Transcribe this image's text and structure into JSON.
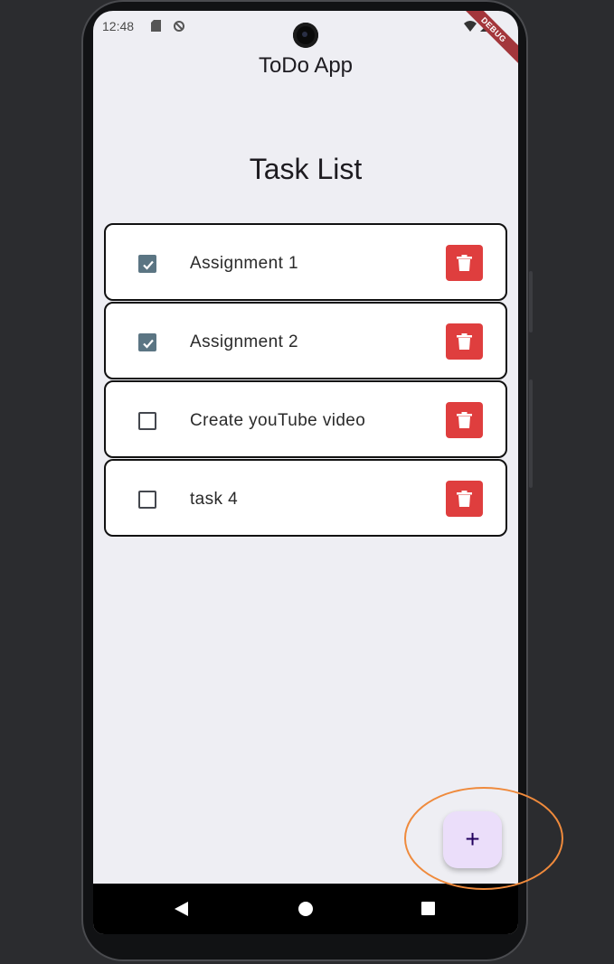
{
  "status_bar": {
    "time": "12:48",
    "icons": [
      "sd-card-icon",
      "sync-icon",
      "wifi-icon",
      "signal-icon"
    ],
    "debug_banner": "DEBUG"
  },
  "app_bar": {
    "title": "ToDo App"
  },
  "main": {
    "heading": "Task List",
    "tasks": [
      {
        "label": "Assignment 1",
        "checked": true
      },
      {
        "label": "Assignment 2",
        "checked": true
      },
      {
        "label": "Create youTube video",
        "checked": false
      },
      {
        "label": "task 4",
        "checked": false
      }
    ],
    "delete_icon": "trash-icon"
  },
  "fab": {
    "label": "+",
    "icon": "plus-icon"
  },
  "nav_bar": {
    "icons": [
      "back-icon",
      "home-icon",
      "recents-icon"
    ]
  },
  "colors": {
    "background": "#eeeef3",
    "delete_button": "#df3e3e",
    "checkbox_checked": "#5b7583",
    "fab_background": "#ebdefa",
    "highlight": "#ef8a3c"
  }
}
